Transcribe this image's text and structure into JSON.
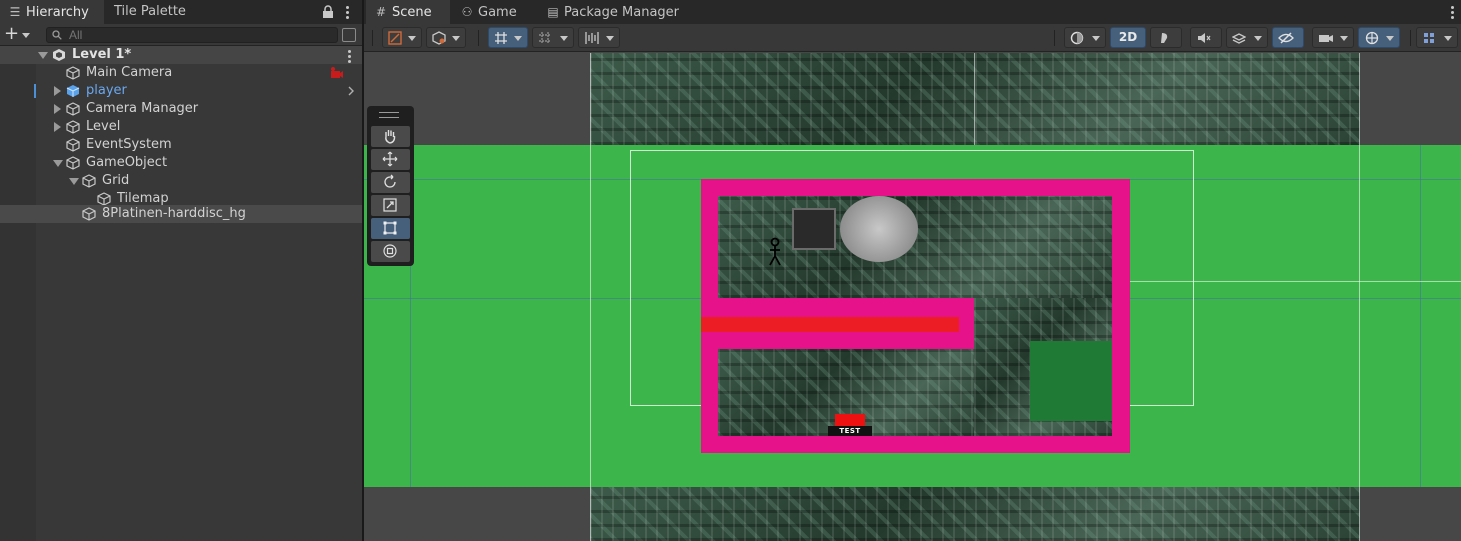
{
  "left_panel": {
    "tabs": [
      {
        "label": "Hierarchy",
        "icon": "list-icon",
        "active": true
      },
      {
        "label": "Tile Palette",
        "active": false
      }
    ],
    "search": {
      "placeholder": "All"
    },
    "tree": [
      {
        "label": "Level 1*",
        "kind": "scene",
        "expanded": true
      },
      {
        "label": "Main Camera",
        "depth": 1
      },
      {
        "label": "player",
        "depth": 1,
        "collapsed": true,
        "color": "#6aa8f0",
        "prefab": true
      },
      {
        "label": "Camera Manager",
        "depth": 1,
        "collapsed": true
      },
      {
        "label": "Level",
        "depth": 1,
        "collapsed": true
      },
      {
        "label": "EventSystem",
        "depth": 1
      },
      {
        "label": "GameObject",
        "depth": 1,
        "expanded": true
      },
      {
        "label": "Grid",
        "depth": 2,
        "expanded": true
      },
      {
        "label": "Tilemap",
        "depth": 3
      },
      {
        "label": "8Platinen-harddisc_hg",
        "depth": 2,
        "selected": true
      }
    ]
  },
  "scene_panel": {
    "tabs": [
      {
        "label": "Scene",
        "icon": "grid-icon",
        "active": true
      },
      {
        "label": "Game",
        "icon": "gamepad-icon",
        "active": false
      },
      {
        "label": "Package Manager",
        "icon": "package-icon",
        "active": false
      }
    ],
    "toolbar": {
      "mode_2d_label": "2D",
      "mode_2d_on": true
    },
    "tools": [
      "hand",
      "move",
      "rotate",
      "scale",
      "rect",
      "transform"
    ],
    "active_tool": "rect",
    "test_label": "TEST"
  },
  "colors": {
    "green": "#3cb54a",
    "magenta": "#e6128a",
    "red": "#ec1d24",
    "accent": "#46607c"
  }
}
